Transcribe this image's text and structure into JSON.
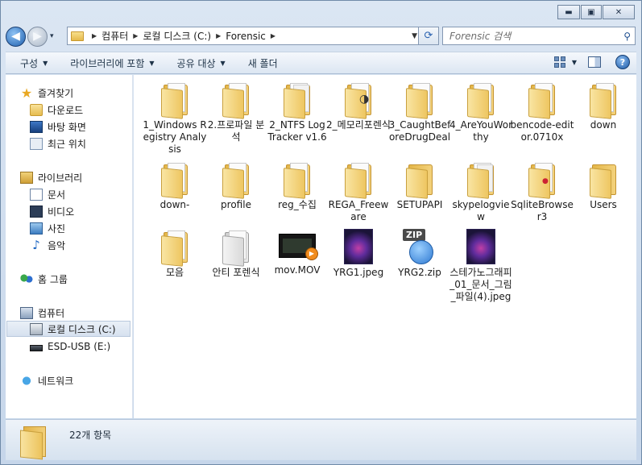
{
  "window": {
    "caption_buttons": [
      {
        "name": "minimize-button",
        "glyph": "▬"
      },
      {
        "name": "maximize-button",
        "glyph": "▣"
      },
      {
        "name": "close-button",
        "glyph": "✕"
      }
    ]
  },
  "nav": {
    "back_glyph": "◀",
    "forward_glyph": "▶",
    "history_glyph": "▾"
  },
  "address": {
    "crumbs": [
      "컴퓨터",
      "로컬 디스크 (C:)",
      "Forensic"
    ],
    "sep": "▶",
    "drop": "▼",
    "refresh_glyph": "⟳"
  },
  "search": {
    "placeholder": "Forensic 검색",
    "icon": "search-icon"
  },
  "toolbar": {
    "commands": [
      "구성",
      "라이브러리에 포함",
      "공유 대상",
      "새 폴더"
    ],
    "caret": "▼",
    "view_drop": "▼",
    "help": "?"
  },
  "navpane": {
    "favorites": {
      "label": "즐겨찾기",
      "items": [
        "다운로드",
        "바탕 화면",
        "최근 위치"
      ]
    },
    "libraries": {
      "label": "라이브러리",
      "items": [
        "문서",
        "비디오",
        "사진",
        "음악"
      ]
    },
    "homegroup": {
      "label": "홈 그룹"
    },
    "computer": {
      "label": "컴퓨터",
      "items": [
        "로컬 디스크 (C:)",
        "ESD-USB (E:)"
      ]
    },
    "network": {
      "label": "네트워크"
    }
  },
  "files": [
    {
      "name": "1_Windows Registry Analysis",
      "type": "folder"
    },
    {
      "name": "2.프로파일 분석",
      "type": "folder"
    },
    {
      "name": "2_NTFS Log Tracker v1.6",
      "type": "folder"
    },
    {
      "name": "2_메모리포렌식",
      "type": "folder"
    },
    {
      "name": "3_CaughtBeforeDrugDeal",
      "type": "folder"
    },
    {
      "name": "4_AreYouWorthy",
      "type": "folder"
    },
    {
      "name": "bencode-editor.0710x",
      "type": "folder"
    },
    {
      "name": "down",
      "type": "folder"
    },
    {
      "name": "down-",
      "type": "folder"
    },
    {
      "name": "profile",
      "type": "folder"
    },
    {
      "name": "reg_수집",
      "type": "folder"
    },
    {
      "name": "REGA_Freeware",
      "type": "folder"
    },
    {
      "name": "SETUPAPI",
      "type": "folder"
    },
    {
      "name": "skypelogview",
      "type": "folder"
    },
    {
      "name": "SqliteBrowser3",
      "type": "folder"
    },
    {
      "name": "Users",
      "type": "folder"
    },
    {
      "name": "모음",
      "type": "folder"
    },
    {
      "name": "안티 포렌식",
      "type": "folder"
    },
    {
      "name": "mov.MOV",
      "type": "video"
    },
    {
      "name": "YRG1.jpeg",
      "type": "image"
    },
    {
      "name": "YRG2.zip",
      "type": "zip",
      "badge": "ZIP"
    },
    {
      "name": "스테가노그래피_01_문서_그림_파일(4).jpeg",
      "type": "image"
    }
  ],
  "status": {
    "count": "22개 항목"
  }
}
